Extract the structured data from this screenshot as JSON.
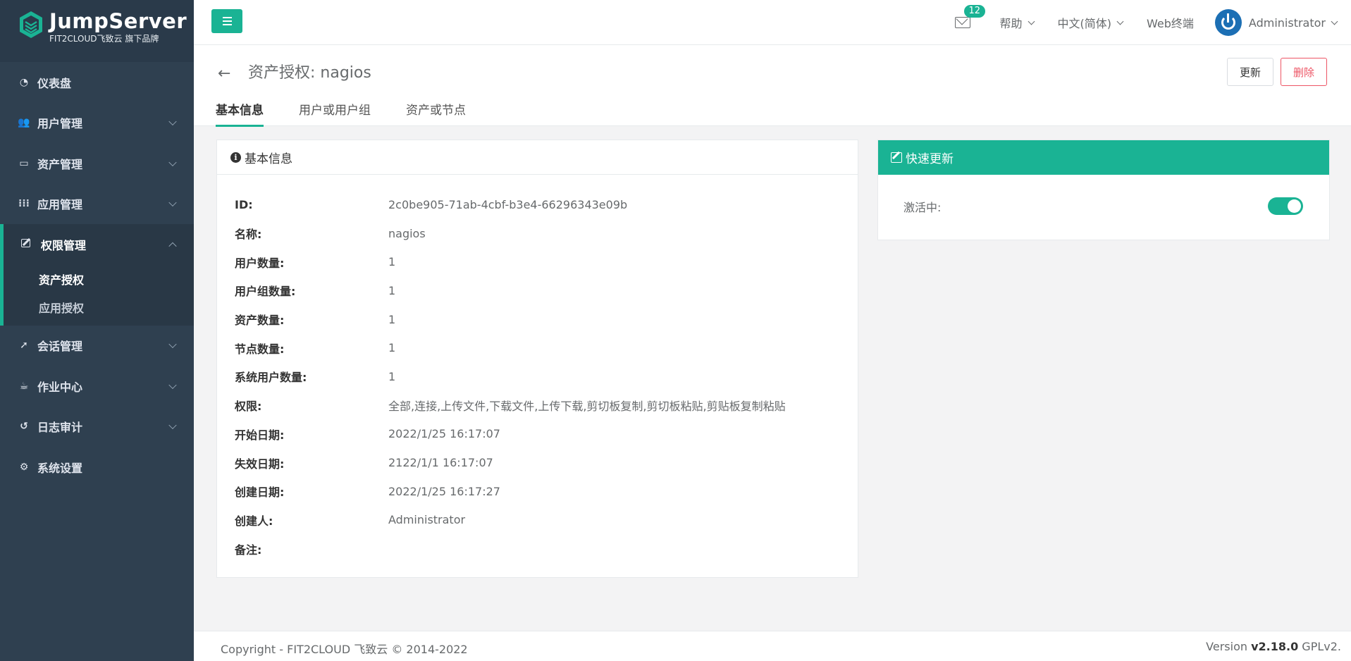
{
  "brand": {
    "name": "JumpServer",
    "sub": "FIT2CLOUD飞致云 旗下品牌"
  },
  "sidebar": {
    "items": [
      {
        "label": "仪表盘",
        "icon": "dashboard-icon"
      },
      {
        "label": "用户管理",
        "icon": "users-icon"
      },
      {
        "label": "资产管理",
        "icon": "inbox-icon"
      },
      {
        "label": "应用管理",
        "icon": "grid-icon"
      },
      {
        "label": "权限管理",
        "icon": "edit-icon",
        "sub": [
          "资产授权",
          "应用授权"
        ]
      },
      {
        "label": "会话管理",
        "icon": "rocket-icon"
      },
      {
        "label": "作业中心",
        "icon": "coffee-icon"
      },
      {
        "label": "日志审计",
        "icon": "history-icon"
      },
      {
        "label": "系统设置",
        "icon": "cogs-icon"
      }
    ]
  },
  "topbar": {
    "mail_count": "12",
    "help": "帮助",
    "language": "中文(简体)",
    "web_terminal": "Web终端",
    "user": "Administrator"
  },
  "page": {
    "title": "资产授权: nagios",
    "update_label": "更新",
    "delete_label": "删除",
    "tabs": [
      "基本信息",
      "用户或用户组",
      "资产或节点"
    ]
  },
  "info": {
    "heading": "基本信息",
    "rows": [
      {
        "label": "ID:",
        "value": "2c0be905-71ab-4cbf-b3e4-66296343e09b"
      },
      {
        "label": "名称:",
        "value": "nagios"
      },
      {
        "label": "用户数量:",
        "value": "1"
      },
      {
        "label": "用户组数量:",
        "value": "1"
      },
      {
        "label": "资产数量:",
        "value": "1"
      },
      {
        "label": "节点数量:",
        "value": "1"
      },
      {
        "label": "系统用户数量:",
        "value": "1"
      },
      {
        "label": "权限:",
        "value": "全部,连接,上传文件,下载文件,上传下载,剪切板复制,剪切板粘贴,剪贴板复制粘贴"
      },
      {
        "label": "开始日期:",
        "value": "2022/1/25 16:17:07"
      },
      {
        "label": "失效日期:",
        "value": "2122/1/1 16:17:07"
      },
      {
        "label": "创建日期:",
        "value": "2022/1/25 16:17:27"
      },
      {
        "label": "创建人:",
        "value": "Administrator"
      },
      {
        "label": "备注:",
        "value": ""
      }
    ]
  },
  "quick": {
    "heading": "快速更新",
    "active_label": "激活中:",
    "active": true
  },
  "footer": {
    "copyright": "Copyright - FIT2CLOUD 飞致云 © 2014-2022",
    "version_prefix": "Version ",
    "version": "v2.18.0",
    "license": " GPLv2."
  },
  "colors": {
    "accent": "#1ab394",
    "sidebar": "#2f4050",
    "danger": "#ed5565"
  }
}
